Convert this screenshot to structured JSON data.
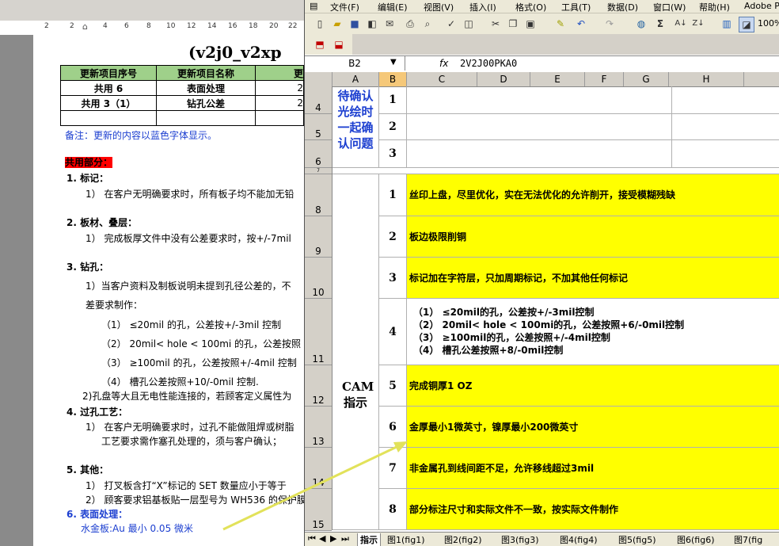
{
  "word": {
    "ruler_numbers": [
      "2",
      "2",
      "4",
      "6",
      "8",
      "10",
      "12",
      "14",
      "16",
      "18",
      "20",
      "22"
    ],
    "title": "(v2j0_v2xp",
    "table": {
      "headers": [
        "更新项目序号",
        "更新项目名称",
        "更"
      ],
      "rows": [
        [
          "共用 6",
          "表面处理",
          "2"
        ],
        [
          "共用 3（1）",
          "钻孔公差",
          "2"
        ],
        [
          "",
          "",
          ""
        ]
      ]
    },
    "note": "备注：更新的内容以蓝色字体显示。",
    "shared_heading": "共用部分：",
    "sec1_title": "1.  标记：",
    "sec1_l1": "1） 在客户无明确要求时，所有板子均不能加无铅",
    "sec2_title": "2.  板材、叠层：",
    "sec2_l1": "1） 完成板厚文件中没有公差要求时，按+/-7mil",
    "sec3_title": "3.  钻孔：",
    "sec3_l1": "1）当客户资料及制板说明未提到孔径公差的，不",
    "sec3_l2": "差要求制作：",
    "sec3_i1": "（1）   ≤20mil 的孔，公差按+/-3mil 控制",
    "sec3_i2": "（2）   20mil< hole < 100mi 的孔，公差按照",
    "sec3_i3": "（3）   ≥100mil 的孔，公差按照+/-4mil 控制",
    "sec3_i4": "（4）   槽孔公差按照+10/-0mil 控制.",
    "sec3_l3": "2)孔盘等大且无电性能连接的，若顾客定义属性为",
    "sec4_title": "4.  过孔工艺：",
    "sec4_l1": "1） 在客户无明确要求时，过孔不能做阻焊或树脂",
    "sec4_l2": "工艺要求需作塞孔处理的，须与客户确认；",
    "sec5_title": "5.  其他：",
    "sec5_l1": "1） 打叉板含打“X”标记的 SET 数量应小于等于",
    "sec5_l2": "2） 顾客要求铝基板贴一层型号为 WH536 的保护膜",
    "sec6_title": "6.  表面处理：",
    "sec6_l1": "水金板:Au 最小 0.05 微米"
  },
  "excel": {
    "menus": [
      "文件(F)",
      "编辑(E)",
      "视图(V)",
      "插入(I)",
      "格式(O)",
      "工具(T)",
      "数据(D)",
      "窗口(W)",
      "帮助(H)",
      "Adobe PD"
    ],
    "zoom": "100%",
    "name_box": "B2",
    "fx_label": "fx",
    "formula": "2V2J00PKA0",
    "columns": [
      "A",
      "B",
      "C",
      "D",
      "E",
      "F",
      "G",
      "H"
    ],
    "rows": [
      "4",
      "5",
      "6",
      "7",
      "8",
      "9",
      "10",
      "11",
      "12",
      "13",
      "14",
      "15"
    ],
    "pending_label": "待确认光绘时一起确认问题",
    "pending_numbers": [
      "1",
      "2",
      "3"
    ],
    "cam_label": "CAM指示",
    "items": [
      {
        "num": "1",
        "text": "丝印上盘，尽里优化，实在无法优化的允许削开，接受模糊残缺"
      },
      {
        "num": "2",
        "text": "板边极限削铜"
      },
      {
        "num": "3",
        "text": "标记加在字符层，只加周期标记，不加其他任何标记"
      },
      {
        "num": "4",
        "lines": [
          "（1）  ≤20mil的孔，公差按+/-3mil控制",
          "（2）  20mil< hole < 100mi的孔，公差按照+6/-0mil控制",
          "（3）  ≥100mil的孔，公差按照+/-4mil控制",
          "（4）  槽孔公差按照+8/-0mil控制"
        ]
      },
      {
        "num": "5",
        "text": "完成铜厚1 OZ"
      },
      {
        "num": "6",
        "text": "金厚最小1微英寸，镍厚最小200微英寸"
      },
      {
        "num": "7",
        "text": "非金属孔到线间距不足，允许移线超过3mil"
      },
      {
        "num": "8",
        "text": "部分标注尺寸和实际文件不一致，按实际文件制作"
      }
    ],
    "sheet_tabs": [
      "指示",
      "图1(fig1)",
      "图2(fig2)",
      "图3(fig3)",
      "图4(fig4)",
      "图5(fig5)",
      "图6(fig6)",
      "图7(fig"
    ],
    "colors": {
      "highlight": "#ffff00",
      "arrow": "#e8e85a",
      "blue_text": "#1c3fd0"
    }
  }
}
